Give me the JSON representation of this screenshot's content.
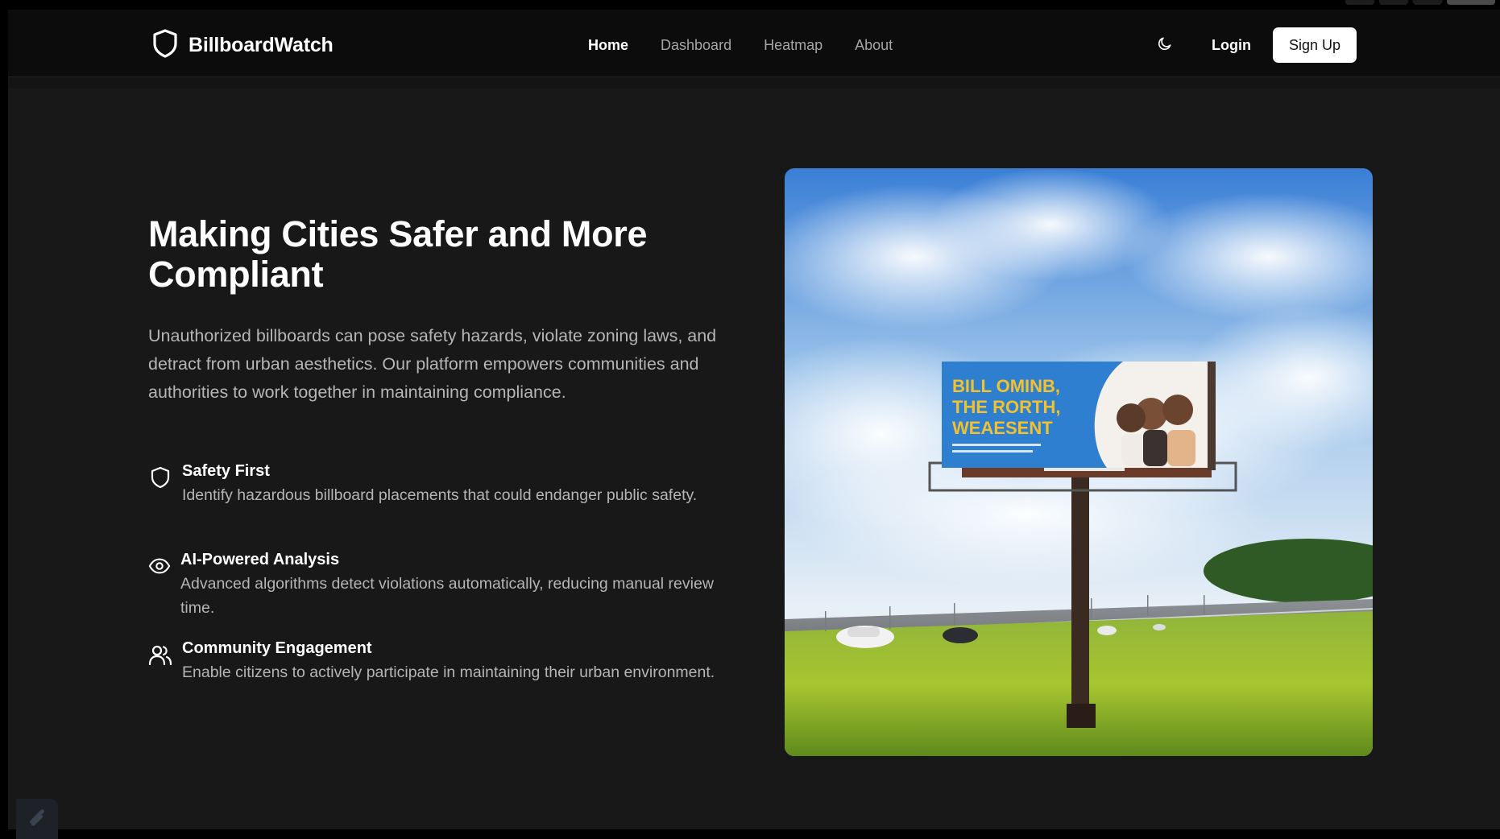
{
  "brand": {
    "name": "BillboardWatch",
    "icon": "shield-icon"
  },
  "nav": {
    "links": [
      {
        "label": "Home",
        "active": true
      },
      {
        "label": "Dashboard",
        "active": false
      },
      {
        "label": "Heatmap",
        "active": false
      },
      {
        "label": "About",
        "active": false
      }
    ],
    "theme_toggle_icon": "moon-icon",
    "login_label": "Login",
    "signup_label": "Sign Up"
  },
  "hero": {
    "title": "Making Cities Safer and More Compliant",
    "description": "Unauthorized billboards can pose safety hazards, violate zoning laws, and detract from urban aesthetics. Our platform empowers communities and authorities to work together in maintaining compliance.",
    "features": [
      {
        "icon": "shield-icon",
        "title": "Safety First",
        "description": "Identify hazardous billboard placements that could endanger public safety."
      },
      {
        "icon": "eye-icon",
        "title": "AI-Powered Analysis",
        "description": "Advanced algorithms detect violations automatically, reducing manual review time."
      },
      {
        "icon": "users-icon",
        "title": "Community Engagement",
        "description": "Enable citizens to actively participate in maintaining their urban environment."
      }
    ],
    "image": {
      "billboard_text_lines": [
        "BILL OMINB,",
        "THE RORTH,",
        "WEAESENT"
      ]
    }
  },
  "colors": {
    "background": "#181818",
    "navbar": "#0c0c0c",
    "text_primary": "#ffffff",
    "text_secondary": "#b5b5b5",
    "nav_inactive": "#a6a6a6",
    "billboard_blue": "#2f7fd0",
    "billboard_yellow": "#f2c12e"
  }
}
